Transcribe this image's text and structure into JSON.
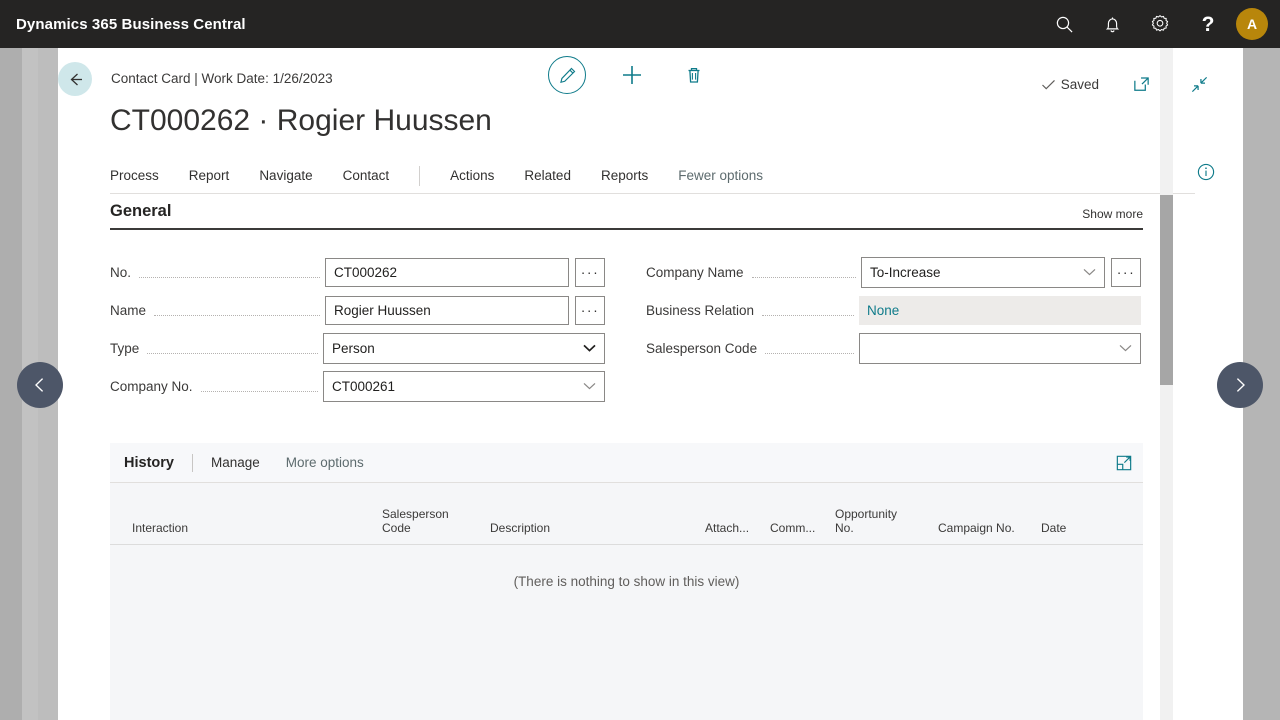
{
  "topbar": {
    "title": "Dynamics 365 Business Central",
    "icons": [
      {
        "name": "search-icon",
        "label": "Search"
      },
      {
        "name": "bell-icon",
        "label": "Notifications"
      },
      {
        "name": "gear-icon",
        "label": "Settings"
      },
      {
        "name": "help-icon",
        "label": "?"
      }
    ],
    "avatar_initial": "A",
    "background": "#252423",
    "avatar_color": "#b8860b"
  },
  "page_header": {
    "back_label": "Back",
    "breadcrumb": "Contact Card | Work Date: 1/26/2023",
    "actions": [
      {
        "name": "edit-button",
        "label": "Edit"
      },
      {
        "name": "new-button",
        "label": "New"
      },
      {
        "name": "delete-button",
        "label": "Delete"
      }
    ],
    "status_text": "Saved",
    "open_new_window_label": "Open in new window",
    "minimize_label": "Collapse"
  },
  "title": "CT000262 · Rogier Huussen",
  "menubar": {
    "items": [
      {
        "label": "Process",
        "muted": false
      },
      {
        "label": "Report",
        "muted": false
      },
      {
        "label": "Navigate",
        "muted": false
      },
      {
        "label": "Contact",
        "muted": false
      }
    ],
    "items2": [
      {
        "label": "Actions",
        "muted": false
      },
      {
        "label": "Related",
        "muted": false
      },
      {
        "label": "Reports",
        "muted": false
      },
      {
        "label": "Fewer options",
        "muted": true
      }
    ],
    "info_label": "Help and information"
  },
  "general": {
    "section_title": "General",
    "show_more": "Show more",
    "left_fields": [
      {
        "label": "No.",
        "value": "CT000262",
        "control": "textbox-assist"
      },
      {
        "label": "Name",
        "value": "Rogier Huussen",
        "control": "textbox-assist"
      },
      {
        "label": "Type",
        "value": "Person",
        "control": "select"
      },
      {
        "label": "Company No.",
        "value": "CT000261",
        "control": "lookup"
      }
    ],
    "right_fields": [
      {
        "label": "Company Name",
        "value": "To-Increase",
        "control": "lookup-assist"
      },
      {
        "label": "Business Relation",
        "value": "None",
        "control": "readonly"
      },
      {
        "label": "Salesperson Code",
        "value": "",
        "control": "lookup"
      }
    ],
    "assist_dots": "···"
  },
  "history": {
    "tab_label": "History",
    "links": [
      {
        "label": "Manage",
        "muted": false
      },
      {
        "label": "More options",
        "muted": true
      }
    ],
    "expand_label": "Open in full view",
    "columns": [
      "Interaction",
      "Salesperson\nCode",
      "Description",
      "Attach...",
      "Comm...",
      "Opportunity\nNo.",
      "Campaign No.",
      "Date"
    ],
    "rows": [],
    "empty_message": "(There is nothing to show in this view)"
  },
  "navigation": {
    "prev_label": "Previous record",
    "next_label": "Next record"
  },
  "colors": {
    "accent_teal": "#0f7b8a",
    "dark_bar": "#252423",
    "readonly_bg": "#edebe9",
    "nav_circle": "#4d5668"
  }
}
